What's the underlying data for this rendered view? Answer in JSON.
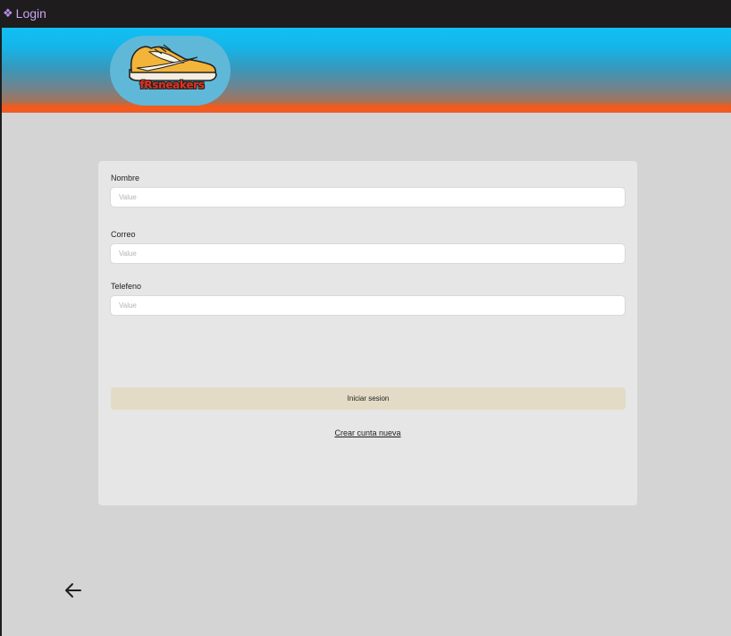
{
  "window": {
    "title": "Login",
    "icon": "component-diamond-icon"
  },
  "header": {
    "logo": {
      "text": "fRsneakers",
      "icon": "sneaker-icon"
    },
    "colors": {
      "top": "#12bff3",
      "bottom": "#ff5614"
    }
  },
  "form": {
    "fields": [
      {
        "label": "Nombre",
        "value": "",
        "placeholder": "Value"
      },
      {
        "label": "Correo",
        "value": "",
        "placeholder": "Value"
      },
      {
        "label": "Telefeno",
        "value": "",
        "placeholder": "Value"
      }
    ],
    "submit_label": "Iniciar sesion",
    "create_link": "Crear cunta nueva"
  },
  "nav": {
    "back_icon": "arrow-left-icon"
  }
}
